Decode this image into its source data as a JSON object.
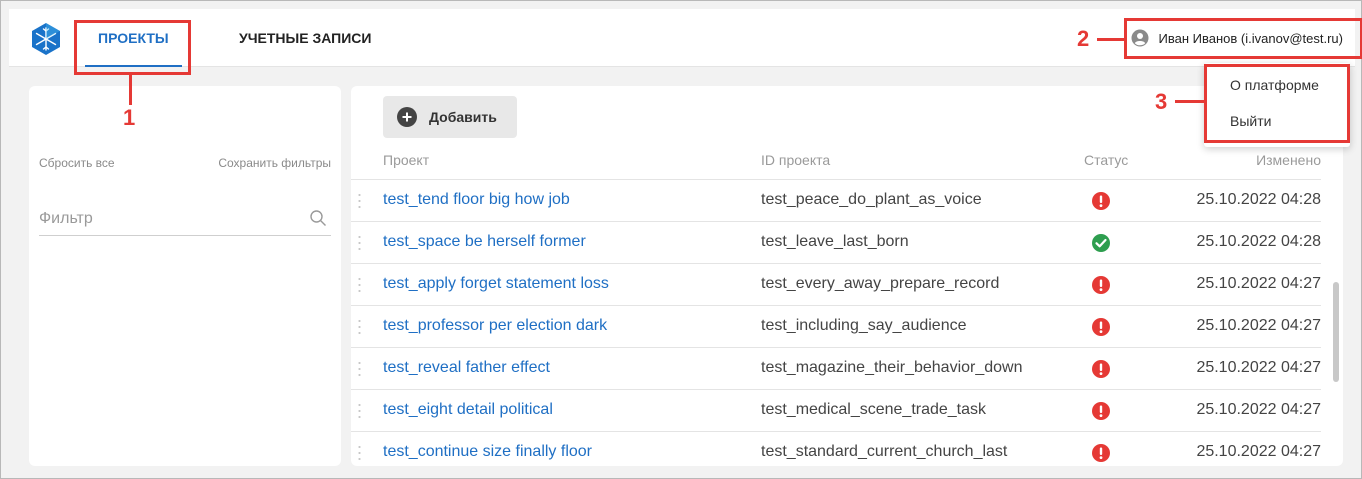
{
  "header": {
    "tabs": [
      {
        "label": "ПРОЕКТЫ",
        "active": true
      },
      {
        "label": "УЧЕТНЫЕ ЗАПИСИ",
        "active": false
      }
    ],
    "user_label": "Иван Иванов (i.ivanov@test.ru)"
  },
  "user_menu": {
    "items": [
      "О платформе",
      "Выйти"
    ]
  },
  "filters": {
    "reset_label": "Сбросить все",
    "save_label": "Сохранить фильтры",
    "placeholder": "Фильтр"
  },
  "main": {
    "add_label": "Добавить",
    "columns": [
      "Проект",
      "ID проекта",
      "Статус",
      "Изменено"
    ],
    "rows": [
      {
        "name": "test_tend floor big how job",
        "id": "test_peace_do_plant_as_voice",
        "status": "error",
        "modified": "25.10.2022 04:28"
      },
      {
        "name": "test_space be herself former",
        "id": "test_leave_last_born",
        "status": "ok",
        "modified": "25.10.2022 04:28"
      },
      {
        "name": "test_apply forget statement loss",
        "id": "test_every_away_prepare_record",
        "status": "error",
        "modified": "25.10.2022 04:27"
      },
      {
        "name": "test_professor per election dark",
        "id": "test_including_say_audience",
        "status": "error",
        "modified": "25.10.2022 04:27"
      },
      {
        "name": "test_reveal father effect",
        "id": "test_magazine_their_behavior_down",
        "status": "error",
        "modified": "25.10.2022 04:27"
      },
      {
        "name": "test_eight detail political",
        "id": "test_medical_scene_trade_task",
        "status": "error",
        "modified": "25.10.2022 04:27"
      },
      {
        "name": "test_continue size finally floor",
        "id": "test_standard_current_church_last",
        "status": "error",
        "modified": "25.10.2022 04:27"
      }
    ]
  },
  "annotations": [
    "1",
    "2",
    "3"
  ],
  "colors": {
    "accent": "#1f6fc4",
    "annotation": "#e53935",
    "status_error": "#e53935",
    "status_ok": "#2e9e4f"
  },
  "icons": {
    "logo": "snowflake-logo",
    "user": "user-circle-icon",
    "search": "search-icon",
    "add": "plus-circle-icon",
    "status_error": "exclamation-circle-icon",
    "status_ok": "check-circle-icon"
  }
}
